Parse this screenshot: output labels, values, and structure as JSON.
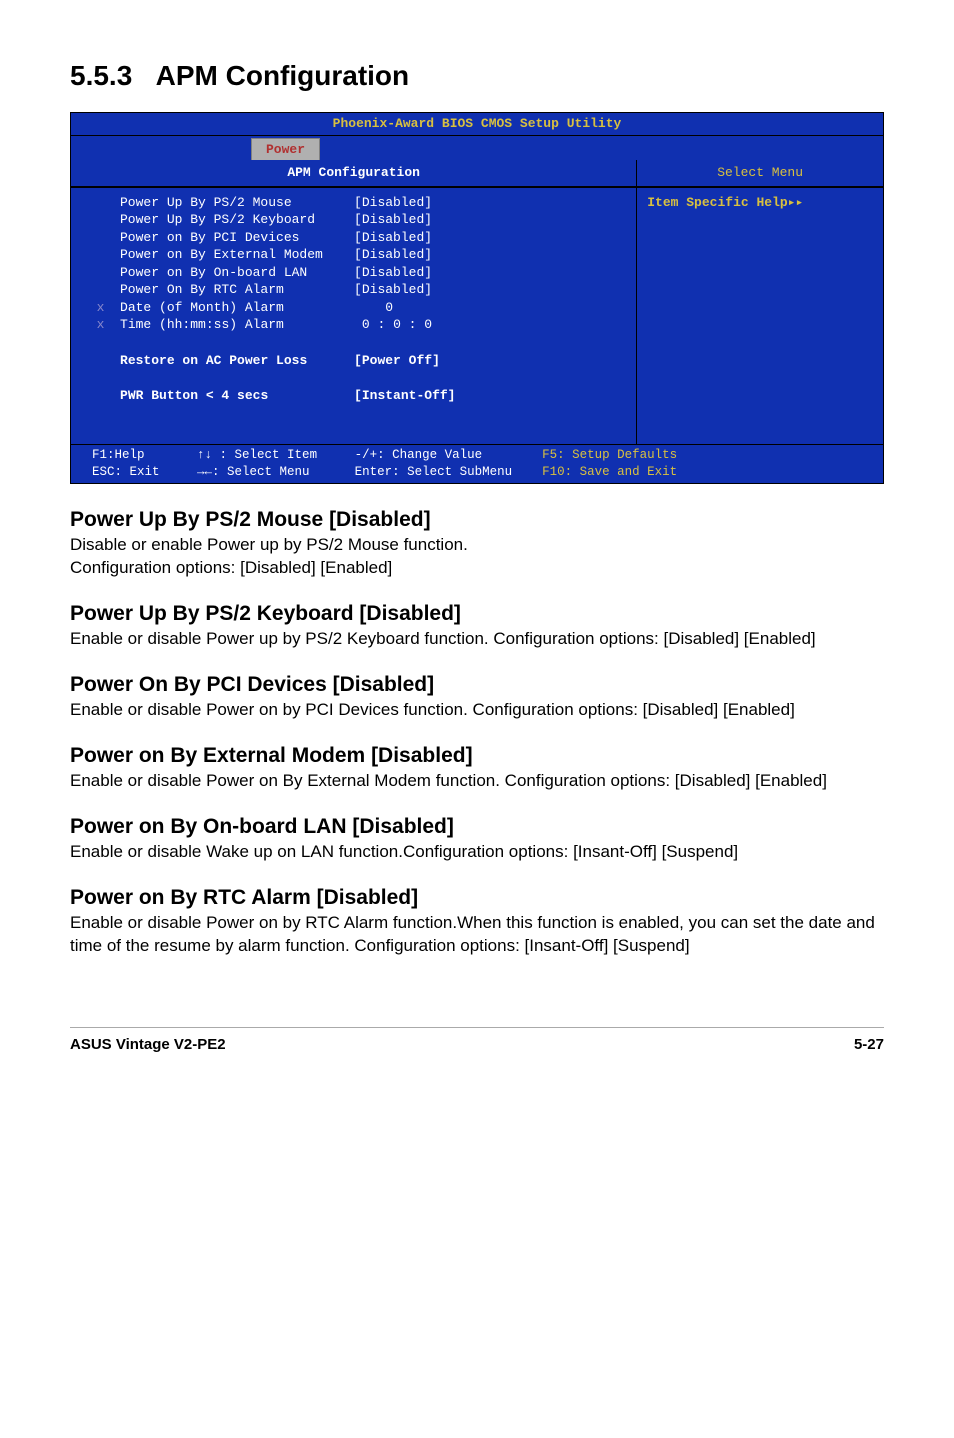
{
  "section": {
    "number": "5.5.3",
    "title": "APM Configuration"
  },
  "bios": {
    "title": "Phoenix-Award BIOS CMOS Setup Utility",
    "tab": "Power",
    "main_header": "APM Configuration",
    "right_header": "Select Menu",
    "items": [
      {
        "x": " ",
        "label": "Power Up By PS/2 Mouse",
        "val": "[Disabled]"
      },
      {
        "x": " ",
        "label": "Power Up By PS/2 Keyboard",
        "val": "[Disabled]"
      },
      {
        "x": " ",
        "label": "Power on By PCI Devices",
        "val": "[Disabled]"
      },
      {
        "x": " ",
        "label": "Power on By External Modem",
        "val": "[Disabled]"
      },
      {
        "x": " ",
        "label": "Power on By On-board LAN",
        "val": "[Disabled]"
      },
      {
        "x": " ",
        "label": "Power On By RTC Alarm",
        "val": "[Disabled]"
      },
      {
        "x": "x",
        "label": "Date (of Month) Alarm",
        "val": "    0"
      },
      {
        "x": "x",
        "label": "Time (hh:mm:ss) Alarm",
        "val": " 0 : 0 : 0"
      }
    ],
    "bold_items": [
      {
        "label": "Restore on AC Power Loss",
        "val": "[Power Off]"
      },
      {
        "label": "PWR Button < 4 secs",
        "val": "[Instant-Off]"
      }
    ],
    "help_text": "Item Specific Help▸▸",
    "footer": {
      "f1": "F1:Help",
      "select_item": ": Select Item",
      "change": "-/+: Change Value",
      "f5": "F5: Setup Defaults",
      "esc": "ESC: Exit",
      "select_menu": ": Select Menu",
      "enter": "Enter: Select SubMenu",
      "f10": "F10: Save and Exit"
    }
  },
  "subsections": [
    {
      "heading": "Power Up By PS/2 Mouse [Disabled]",
      "body": "Disable or enable Power up by PS/2 Mouse function.\nConfiguration options: [Disabled] [Enabled]"
    },
    {
      "heading": "Power Up By PS/2 Keyboard [Disabled]",
      "body": "Enable or disable Power up by PS/2 Keyboard function. Configuration options: [Disabled] [Enabled]"
    },
    {
      "heading": "Power On By PCI Devices [Disabled]",
      "body": "Enable or disable Power on by PCI Devices function. Configuration options: [Disabled] [Enabled]"
    },
    {
      "heading": "Power on By External Modem [Disabled]",
      "body": "Enable or disable Power on By External Modem function. Configuration options: [Disabled] [Enabled]"
    },
    {
      "heading": "Power on By On-board LAN [Disabled]",
      "body": "Enable or disable Wake up on LAN function.Configuration options: [Insant-Off] [Suspend]"
    },
    {
      "heading": "Power on By RTC Alarm [Disabled]",
      "body": "Enable or disable Power on by RTC Alarm function.When this function is enabled, you can set the date and time of the resume by alarm function. Configuration options: [Insant-Off] [Suspend]"
    }
  ],
  "footer": {
    "left": "ASUS Vintage V2-PE2",
    "right": "5-27"
  }
}
